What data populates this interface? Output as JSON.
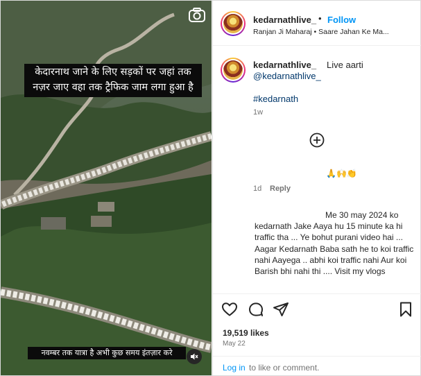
{
  "media": {
    "caption_top": "केदारनाथ जाने के लिए सड़कों पर जहां तक नज़र जाए वहा तक ट्रैफिक जाम लगा हुआ है",
    "caption_bottom": "नवम्बर तक यात्रा है अभी कुछ समय इंतज़ार करे",
    "icons": {
      "reel": "camera-icon",
      "audio": "speaker-muted-icon"
    }
  },
  "header": {
    "username": "kedarnathlive_",
    "separator": "•",
    "follow_label": "Follow",
    "audio_text": "Ranjan Ji Maharaj • Saare Jahan Ke Ma..."
  },
  "caption": {
    "username": "kedarnathlive_",
    "text": "Live aarti",
    "mention": "@kedarnathlive_",
    "hashtag": "#kedarnath",
    "time": "1w"
  },
  "comments": [
    {
      "text": "🙏🙌👏",
      "time": "1d",
      "reply_label": "Reply"
    },
    {
      "first_line": "Me 30 may 2024 ko",
      "text": "kedarnath Jake Aaya hu 15 minute ka hi traffic tha ... Ye bohut purani video hai ... Aagar Kedarnath Baba sath he to koi traffic nahi Aayega .. abhi koi traffic nahi Aur koi Barish bhi nahi thi .... Visit my vlogs"
    }
  ],
  "actions": {
    "icons": [
      "heart-icon",
      "comment-icon",
      "share-icon",
      "bookmark-icon"
    ],
    "likes": "19,519 likes",
    "date": "May 22"
  },
  "footer": {
    "login_label": "Log in",
    "login_rest": "to like or comment."
  },
  "colors": {
    "link_blue": "#0095f6",
    "hashtag_blue": "#00376b",
    "muted_text": "#737373"
  }
}
